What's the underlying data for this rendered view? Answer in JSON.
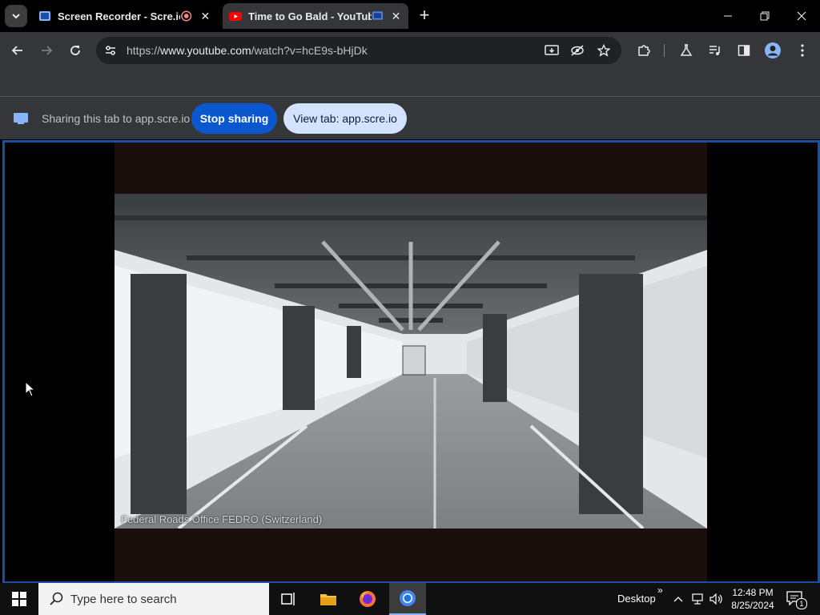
{
  "browser": {
    "tabs": [
      {
        "title": "Screen Recorder - Scre.io",
        "active": false
      },
      {
        "title": "Time to Go Bald - YouTube",
        "active": true
      }
    ],
    "url_scheme": "https://",
    "url_host": "www.youtube.com",
    "url_path": "/watch?v=hcE9s-bHjDk"
  },
  "sharing": {
    "message": "Sharing this tab to app.scre.io",
    "stop_label": "Stop sharing",
    "view_label": "View tab: app.scre.io"
  },
  "video": {
    "caption": "Federal Roads Office FEDRO (Switzerland)"
  },
  "taskbar": {
    "search_placeholder": "Type here to search",
    "desktop_label": "Desktop",
    "time": "12:48 PM",
    "date": "8/25/2024",
    "notification_count": "1"
  },
  "colors": {
    "share_accent": "#0b57d0",
    "view_button_bg": "#d3e3fd",
    "sharing_border": "#1a4fa3",
    "youtube_red": "#ff0000"
  }
}
